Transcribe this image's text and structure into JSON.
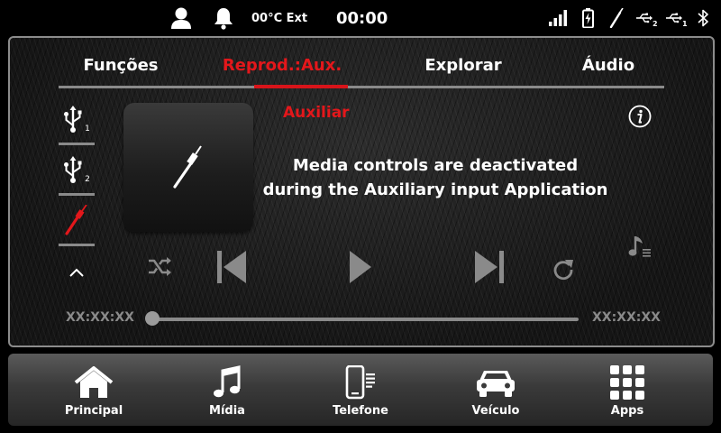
{
  "status_bar": {
    "temperature": "00°C Ext",
    "clock": "00:00",
    "usb1_sub": "2",
    "usb2_sub": "1"
  },
  "tabs": [
    {
      "label": "Funções"
    },
    {
      "label": "Reprod.:Aux."
    },
    {
      "label": "Explorar"
    },
    {
      "label": "Áudio"
    }
  ],
  "sources": [
    {
      "sub": "1"
    },
    {
      "sub": "2"
    }
  ],
  "player": {
    "source_title": "Auxiliar",
    "message_line1": "Media controls are deactivated",
    "message_line2": "during the Auxiliary input Application",
    "elapsed": "XX:XX:XX",
    "remaining": "XX:XX:XX",
    "progress": 0
  },
  "dock": [
    {
      "label": "Principal"
    },
    {
      "label": "Mídia"
    },
    {
      "label": "Telefone"
    },
    {
      "label": "Veículo"
    },
    {
      "label": "Apps"
    }
  ],
  "colors": {
    "accent": "#e3171b",
    "disabled": "#8a8a8a"
  }
}
